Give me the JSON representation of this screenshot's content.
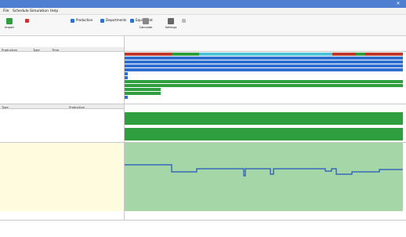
{
  "window": {
    "title": "",
    "close_glyph": "✕"
  },
  "menu": [
    {
      "label": "File"
    },
    {
      "label": "Schedule"
    },
    {
      "label": "Simulation"
    },
    {
      "label": "Help"
    }
  ],
  "ribbon": {
    "import_label": "Import",
    "tool1_label": "",
    "tool2_label": "Production",
    "tool3_label": "Departments",
    "tool4_label": "Equipment",
    "tool5_label": "",
    "calc_label": "Calculate",
    "settings_label": "Settings",
    "group1_label": "",
    "group2_label": "",
    "group3_label": "",
    "group4_label": "",
    "accent": "#2f6fd0",
    "green": "#2e9e3e"
  },
  "table": {
    "headers": [
      "Production",
      "Type",
      "Time",
      "",
      ""
    ],
    "rows": [
      {
        "c1": "",
        "c2": "",
        "c3": "",
        "selected": false
      },
      {
        "c1": "",
        "c2": "",
        "c3": "",
        "selected": false
      },
      {
        "c1": "",
        "c2": "",
        "c3": "",
        "selected": false
      },
      {
        "c1": "",
        "c2": "",
        "c3": "",
        "selected": false
      },
      {
        "c1": "",
        "c2": "",
        "c3": "",
        "selected": false
      },
      {
        "c1": "",
        "c2": "",
        "c3": "",
        "selected": false
      },
      {
        "c1": "",
        "c2": "",
        "c3": "",
        "selected": false
      },
      {
        "c1": "",
        "c2": "",
        "c3": "",
        "selected": false
      },
      {
        "c1": "",
        "c2": "",
        "c3": "",
        "selected": false
      },
      {
        "c1": "",
        "c2": "",
        "c3": "",
        "selected": false
      },
      {
        "c1": "",
        "c2": "",
        "c3": "",
        "selected": false
      },
      {
        "c1": "",
        "c2": "",
        "c3": "",
        "selected": false
      },
      {
        "c1": "",
        "c2": "",
        "c3": "",
        "selected": false
      }
    ]
  },
  "timeline": {
    "start_label": "",
    "mid_label": "",
    "end_label": "",
    "days": [
      "",
      "",
      "",
      "",
      "",
      "",
      "",
      ""
    ]
  },
  "resources": {
    "headers": [
      "Type",
      "Production"
    ],
    "rows": [
      {
        "c1": "",
        "c2": ""
      },
      {
        "c1": "",
        "c2": ""
      },
      {
        "c1": "",
        "c2": ""
      },
      {
        "c1": "",
        "c2": ""
      },
      {
        "c1": "",
        "c2": ""
      },
      {
        "c1": "",
        "c2": ""
      },
      {
        "c1": "",
        "c2": ""
      },
      {
        "c1": "",
        "c2": ""
      },
      {
        "c1": "",
        "c2": ""
      },
      {
        "c1": "",
        "c2": ""
      }
    ]
  },
  "chart": {
    "legend_title": "",
    "y_ticks": [
      "",
      "",
      "",
      "",
      "",
      "",
      "",
      "",
      "",
      "",
      ""
    ],
    "line_color": "#2255bb",
    "fill_color": "#a5d6a7"
  },
  "bottom": {
    "left_label": "",
    "t1": "",
    "t2": "",
    "t3": ""
  }
}
